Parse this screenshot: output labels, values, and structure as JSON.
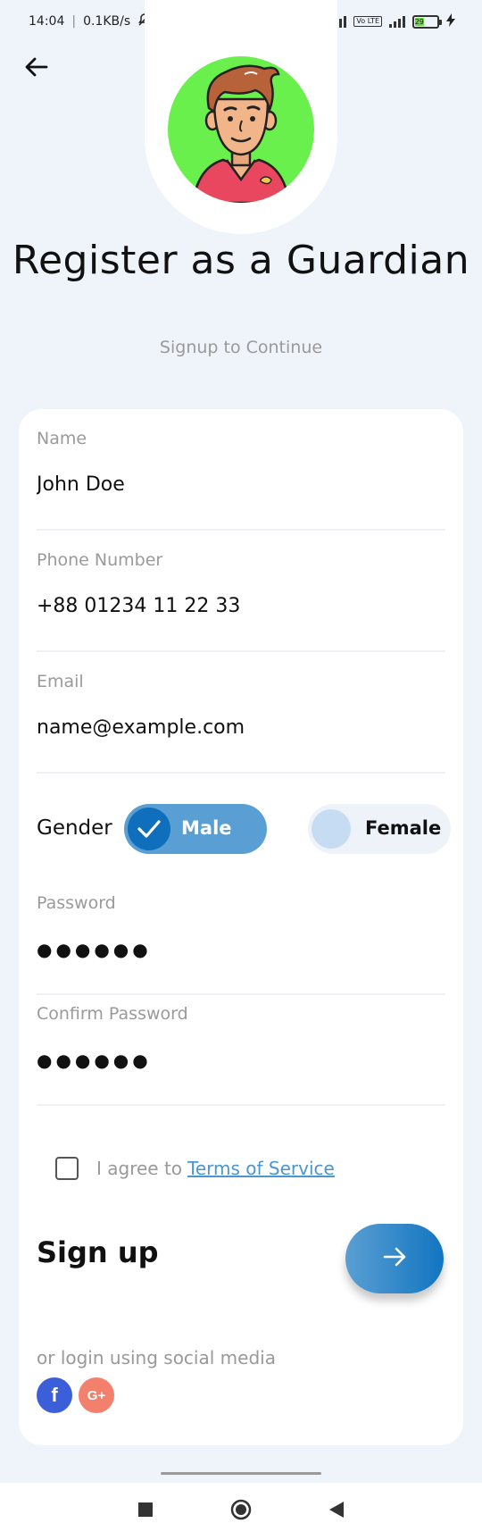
{
  "status_bar": {
    "time": "14:04",
    "separator": "|",
    "speed": "0.1KB/s",
    "network_type": "Vo LTE",
    "battery_level": "29"
  },
  "header": {
    "title": "Register as a Guardian",
    "subtitle": "Signup to Continue"
  },
  "form": {
    "fields": [
      {
        "label": "Name",
        "value": "John Doe"
      },
      {
        "label": "Phone Number",
        "value": "+88 01234 11 22 33"
      },
      {
        "label": "Email",
        "value": "name@example.com"
      }
    ],
    "gender": {
      "label": "Gender",
      "options": [
        "Male",
        "Female"
      ],
      "selected": "Male"
    },
    "password": {
      "label": "Password",
      "value": "●●●●●●"
    },
    "confirm_password": {
      "label": "Confirm Password",
      "value": "●●●●●●"
    },
    "terms": {
      "text": "I agree to",
      "link": "Terms of Service",
      "checked": false
    },
    "signup_label": "Sign up",
    "social_text": "or login using social media",
    "social": [
      "f",
      "G+"
    ]
  },
  "colors": {
    "accent": "#1275c1",
    "accent_light": "#5a9fd3",
    "background": "#eff3fa",
    "avatar_bg": "#6af04c",
    "facebook": "#3b5fd8",
    "google": "#f2806d"
  },
  "icons": {
    "back": "arrow-left-icon",
    "check": "check-icon",
    "next": "arrow-right-icon"
  }
}
